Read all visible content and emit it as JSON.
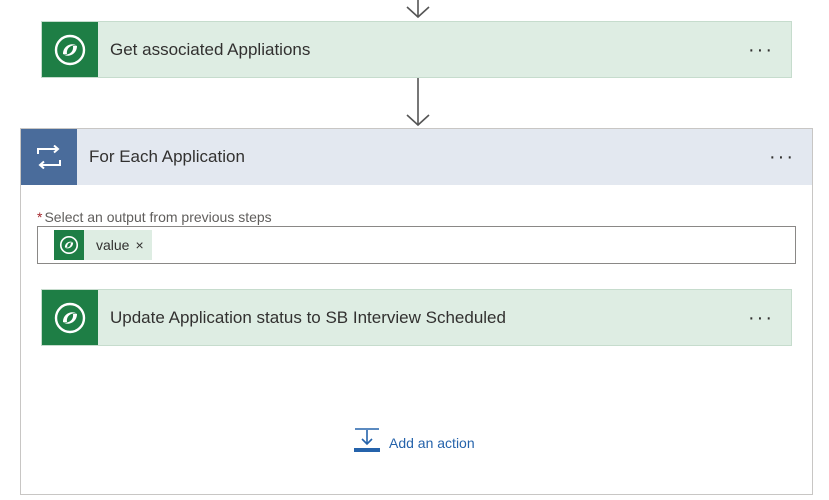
{
  "flow": {
    "steps": [
      {
        "title": "Get associated Appliations",
        "icon": "dataverse-icon",
        "more_label": "···"
      }
    ],
    "loop": {
      "title": "For Each Application",
      "icon": "loop-icon",
      "more_label": "···",
      "field": {
        "required_marker": "*",
        "label": "Select an output from previous steps",
        "token": {
          "label": "value",
          "icon": "dataverse-icon",
          "remove_label": "×"
        }
      },
      "inner_steps": [
        {
          "title": "Update Application status to SB Interview Scheduled",
          "icon": "dataverse-icon",
          "more_label": "···"
        }
      ],
      "add_action": {
        "label": "Add an action",
        "icon": "add-action-icon"
      }
    }
  },
  "colors": {
    "dataverse_green": "#1e7e45",
    "step_bg": "#deede3",
    "loop_blue": "#4a6c9b",
    "loop_header_bg": "#e3e8f0",
    "link_blue": "#2563ab",
    "required_red": "#a4262c"
  }
}
